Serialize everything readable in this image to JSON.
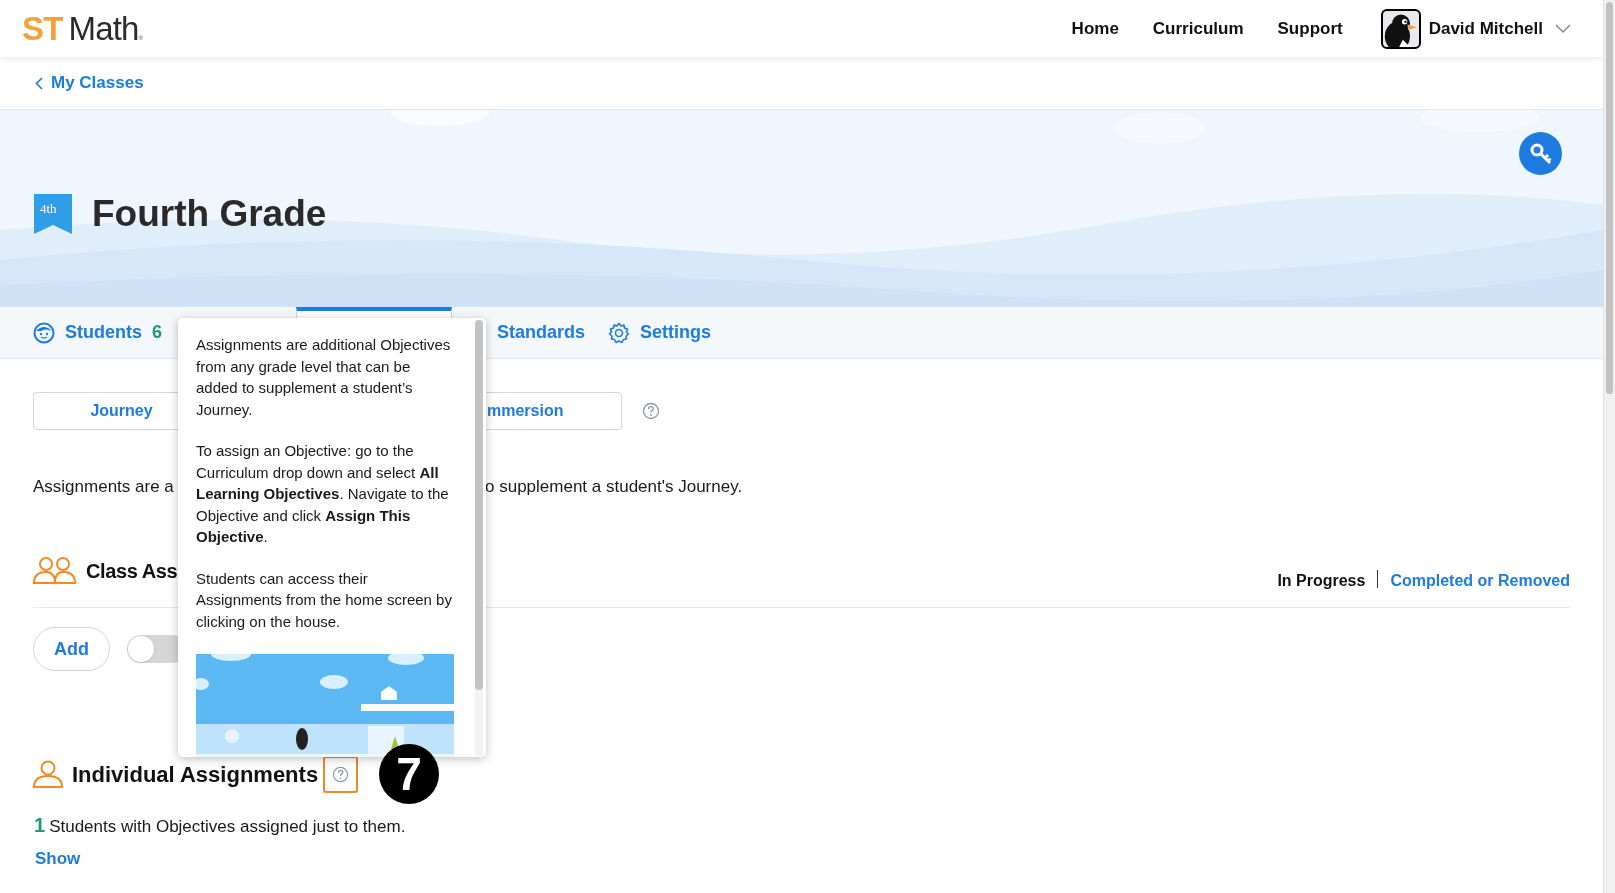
{
  "header": {
    "logo": {
      "brand": "ST",
      "product": "Math",
      "mark": "®"
    },
    "nav": [
      "Home",
      "Curriculum",
      "Support"
    ],
    "user": {
      "name": "David Mitchell"
    }
  },
  "back_link": "My Classes",
  "banner": {
    "grade_badge": "4th",
    "title": "Fourth Grade"
  },
  "tabs": [
    {
      "label": "Students",
      "count": "6",
      "kind": "students",
      "selected": false
    },
    {
      "kind": "hidden",
      "selected": true
    },
    {
      "label": "Standards",
      "kind": "standards",
      "selected": false
    },
    {
      "label": "Settings",
      "kind": "settings",
      "selected": false
    }
  ],
  "mode_buttons": [
    "Journey",
    "mmersion"
  ],
  "description": [
    "Assignments are a",
    "o supplement a student's Journey."
  ],
  "class_assignments": {
    "title": "Class Ass",
    "filters": [
      {
        "label": "In Progress",
        "selected": true
      },
      {
        "label": "Completed or Removed",
        "selected": false
      }
    ],
    "add_button": "Add",
    "toggle": {
      "on": false
    }
  },
  "individual_assignments": {
    "title": "Individual Assignments",
    "count": "1",
    "text": "Students with Objectives assigned just to them.",
    "show_link": "Show"
  },
  "popover": {
    "paragraphs": [
      "Assignments are additional Objectives from any grade level that can be added to supplement a student’s Journey.",
      "To assign an Objective: go to the Curriculum drop down and select **All Learning Objectives**. Navigate to the Objective and click **Assign This Objective**.",
      "Students can access their Assignments from the home screen by clicking on the house."
    ],
    "image": {
      "kind": "picture"
    }
  },
  "step_badge": "7"
}
